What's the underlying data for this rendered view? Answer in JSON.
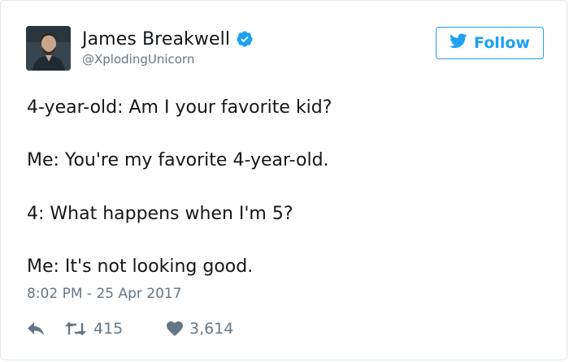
{
  "author": {
    "display_name": "James Breakwell",
    "handle": "@XplodingUnicorn",
    "verified": true
  },
  "follow_button": {
    "label": "Follow"
  },
  "tweet": {
    "lines": [
      "4-year-old: Am I your favorite kid?",
      "Me: You're my favorite 4-year-old.",
      "4: What happens when I'm 5?",
      "Me: It's not looking good."
    ],
    "timestamp": "8:02 PM - 25 Apr 2017"
  },
  "actions": {
    "retweet_count": "415",
    "like_count": "3,614"
  },
  "icons": {
    "verified": "verified-badge-icon",
    "follow": "twitter-bird-icon",
    "reply": "reply-arrow-icon",
    "retweet": "retweet-icon",
    "like": "heart-icon"
  },
  "colors": {
    "accent": "#1da1f2",
    "text": "#14171a",
    "secondary": "#657786",
    "border": "#e1e8ed"
  }
}
